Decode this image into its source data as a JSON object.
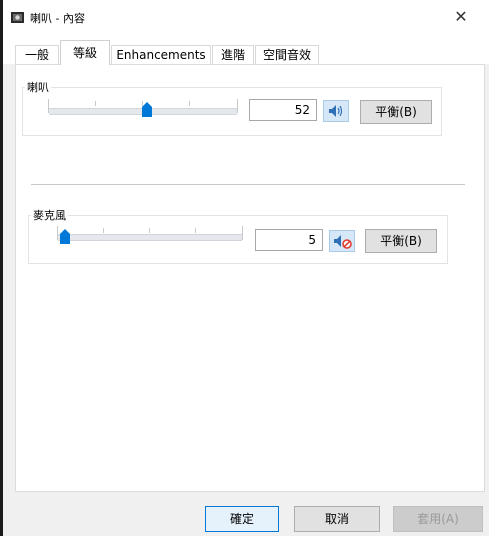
{
  "window": {
    "title": "喇叭 - 內容",
    "close_glyph": "✕",
    "icon": "speaker-icon"
  },
  "tabs": [
    {
      "label": "一般",
      "active": false
    },
    {
      "label": "等級",
      "active": true
    },
    {
      "label": "Enhancements",
      "active": false
    },
    {
      "label": "進階",
      "active": false
    },
    {
      "label": "空間音效",
      "active": false
    }
  ],
  "levels": {
    "speaker": {
      "label": "喇叭",
      "value": "52",
      "mute_icon": "speaker-volume-icon",
      "muted": false,
      "balance_label": "平衡(B)"
    },
    "microphone": {
      "label": "麥克風",
      "value": "5",
      "mute_icon": "speaker-muted-icon",
      "muted": true,
      "balance_label": "平衡(B)"
    }
  },
  "buttons": {
    "ok": "確定",
    "cancel": "取消",
    "apply": "套用(A)",
    "apply_enabled": false
  },
  "colors": {
    "accent": "#0078d7",
    "mute_indicator": "#e03c31"
  }
}
